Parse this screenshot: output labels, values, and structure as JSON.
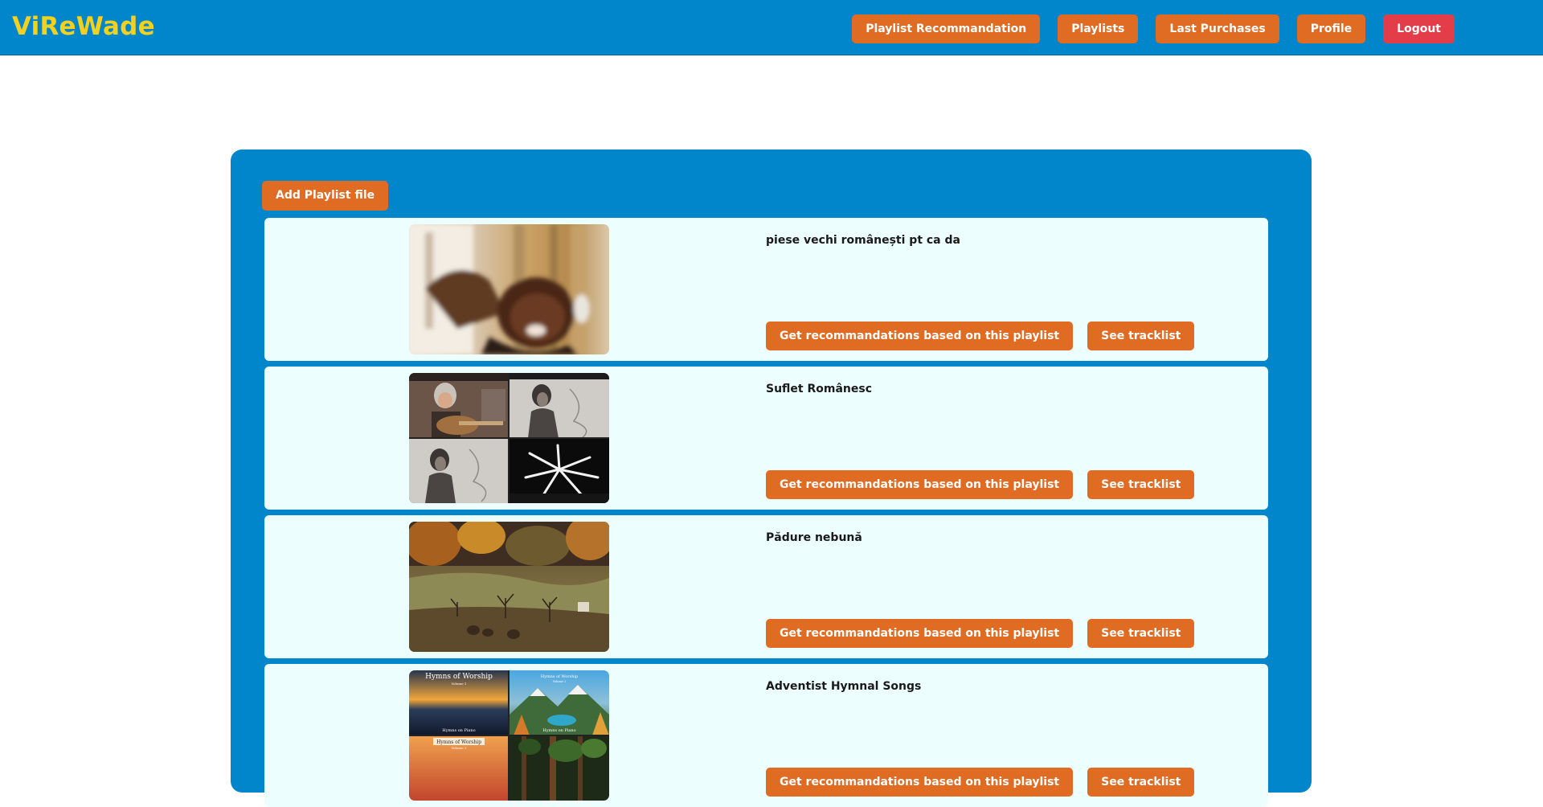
{
  "app": {
    "brand": "ViReWade"
  },
  "nav": {
    "items": [
      {
        "label": "Playlist Recommandation",
        "name": "nav-playlist-recommandation-button"
      },
      {
        "label": "Playlists",
        "name": "nav-playlists-button"
      },
      {
        "label": "Last Purchases",
        "name": "nav-last-purchases-button"
      },
      {
        "label": "Profile",
        "name": "nav-profile-button"
      },
      {
        "label": "Logout",
        "name": "nav-logout-button"
      }
    ]
  },
  "main": {
    "add_playlist_label": "Add Playlist file",
    "recommend_label": "Get recommandations based on this playlist",
    "tracklist_label": "See tracklist",
    "playlists": [
      {
        "title": "piese vechi românești pt ca da",
        "cover": "blurred-person-headphones-cover"
      },
      {
        "title": "Suflet Românesc",
        "cover": "four-panel-guitarist-collage-cover"
      },
      {
        "title": "Pădure nebună",
        "cover": "autumn-forest-meadow-cover"
      },
      {
        "title": "Adventist Hymnal Songs",
        "cover": "hymns-of-worship-collage-cover",
        "cover_text": {
          "top_left_title": "Hymns of Worship",
          "top_left_sub": "Volume 1",
          "top_left_foot": "Hymns on Piano",
          "top_right_title": "Hymns of Worship",
          "top_right_sub": "Volume 2",
          "top_right_foot": "Hymns on Piano",
          "bottom_left_title": "Hymns of Worship",
          "bottom_left_sub": "Volume 3"
        }
      }
    ]
  },
  "colors": {
    "header_bg": "#0286cb",
    "brand": "#f2d21e",
    "button": "#e06b22",
    "logout": "#e23d48",
    "card_bg": "#edfefe"
  }
}
